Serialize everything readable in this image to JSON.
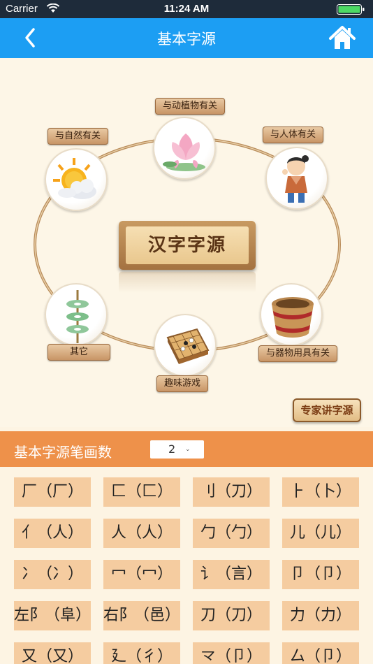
{
  "status_bar": {
    "carrier": "Carrier",
    "time": "11:24 AM"
  },
  "nav": {
    "title": "基本字源"
  },
  "hero": {
    "center_title": "汉字字源",
    "categories": [
      "与动植物有关",
      "与自然有关",
      "与人体有关",
      "其它",
      "与器物用具有关",
      "趣味游戏"
    ],
    "expert_button": "专家讲字源"
  },
  "filter": {
    "label": "基本字源笔画数",
    "stroke_count": "2"
  },
  "radicals": [
    "厂（厂）",
    "匚（匚）",
    "刂（刀）",
    "⺊（卜）",
    "亻（人）",
    "人（人）",
    "勹（勹）",
    "儿（儿）",
    "冫（冫）",
    "冖（冖）",
    "讠（言）",
    "卩（卩）",
    "左阝（阜）",
    "右阝（邑）",
    "刀（刀）",
    "力（力）",
    "又（又）",
    "廴（彳）",
    "龴（卩）",
    "厶（卩）"
  ],
  "colors": {
    "nav_blue": "#1c9ef3",
    "filter_orange": "#ee914a",
    "cell_bg": "#f5cca0"
  }
}
